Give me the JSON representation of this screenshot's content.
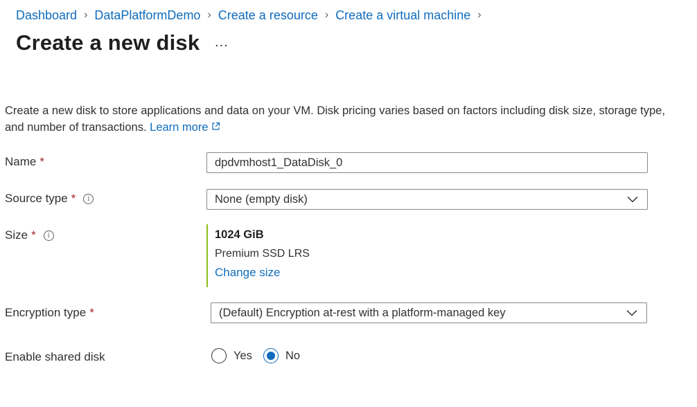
{
  "breadcrumb": {
    "items": [
      "Dashboard",
      "DataPlatformDemo",
      "Create a resource",
      "Create a virtual machine"
    ],
    "separator": ">"
  },
  "page": {
    "title": "Create a new disk",
    "more_label": "..."
  },
  "description": {
    "text": "Create a new disk to store applications and data on your VM. Disk pricing varies based on factors including disk size, storage type, and number of transactions.",
    "learn_more": "Learn more",
    "learn_more_icon": "external-link-icon"
  },
  "form": {
    "required_marker": "*",
    "name": {
      "label": "Name",
      "value": "dpdvmhost1_DataDisk_0"
    },
    "source_type": {
      "label": "Source type",
      "value": "None (empty disk)"
    },
    "size": {
      "label": "Size",
      "value": "1024 GiB",
      "tier": "Premium SSD LRS",
      "change_link": "Change size"
    },
    "encryption": {
      "label": "Encryption type",
      "value": "(Default) Encryption at-rest with a platform-managed key"
    },
    "shared_disk": {
      "label": "Enable shared disk",
      "options": [
        "Yes",
        "No"
      ],
      "selected": "No"
    }
  },
  "colors": {
    "link": "#0f6cbd",
    "required": "#a4262c",
    "accent_bar": "#8cbd18"
  }
}
